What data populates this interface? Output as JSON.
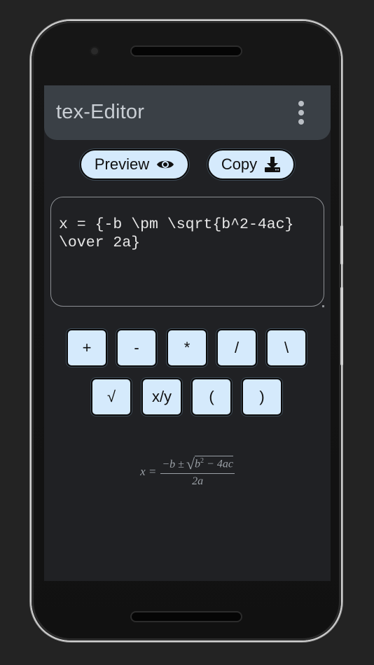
{
  "app": {
    "title": "tex-Editor"
  },
  "toolbar": {
    "preview_label": "Preview",
    "copy_label": "Copy"
  },
  "editor": {
    "value": "x = {-b \\pm \\sqrt{b^2-4ac} \\over 2a}"
  },
  "keys": [
    "+",
    "-",
    "*",
    "/",
    "\\",
    "√",
    "x/y",
    "(",
    ")"
  ],
  "preview": {
    "lhs": "x =",
    "neg_b": "−b ±",
    "b": "b",
    "exp": "2",
    "rest": " − 4ac",
    "denominator": "2a"
  },
  "colors": {
    "button_bg": "#d5eafc",
    "appbar_bg": "#3a4046",
    "screen_bg": "#202124"
  },
  "icons": {
    "menu": "more-vert-icon",
    "preview": "eye-icon",
    "copy": "download-icon"
  }
}
